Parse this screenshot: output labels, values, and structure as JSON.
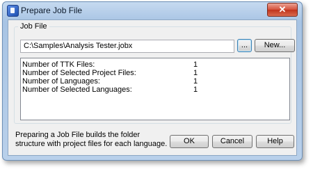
{
  "window": {
    "title": "Prepare Job File",
    "close_glyph": "✕",
    "icon": "app-icon"
  },
  "job_file": {
    "group_label": "Job File",
    "path_value": "C:\\Samples\\Analysis Tester.jobx",
    "browse_label": "...",
    "new_label": "New..."
  },
  "stats": [
    {
      "label": "Number of TTK Files:",
      "value": "1"
    },
    {
      "label": "Number of Selected Project Files:",
      "value": "1"
    },
    {
      "label": "Number of Languages:",
      "value": "1"
    },
    {
      "label": "Number of Selected Languages:",
      "value": "1"
    }
  ],
  "footer": {
    "description": "Preparing a Job File builds the folder structure with project files for each language.",
    "ok_label": "OK",
    "cancel_label": "Cancel",
    "help_label": "Help"
  }
}
